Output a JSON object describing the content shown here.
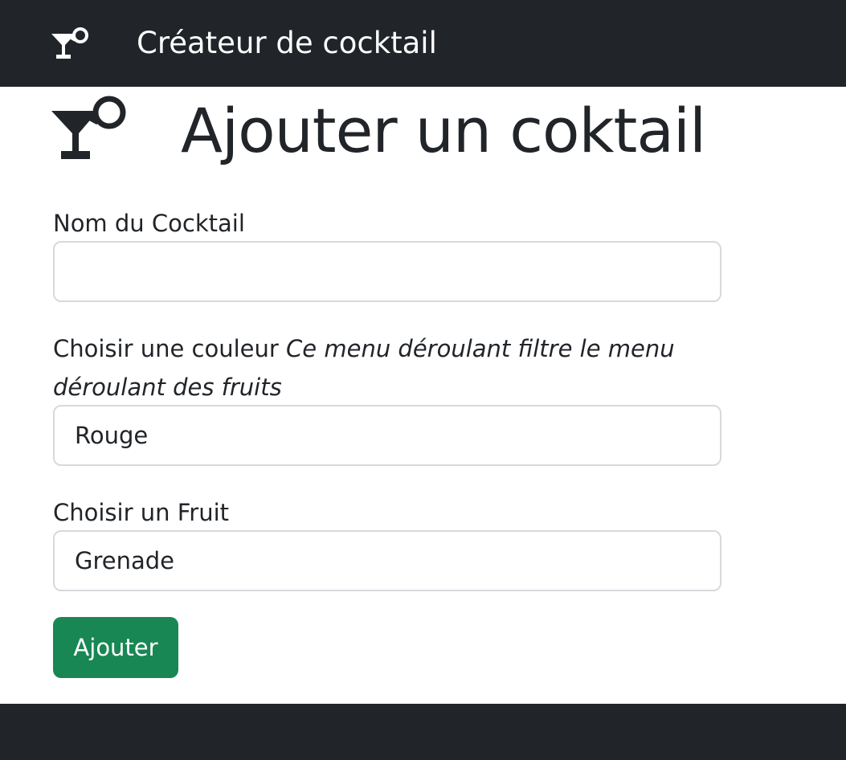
{
  "navbar": {
    "icon": "cocktail-icon",
    "title": "Créateur de cocktail"
  },
  "page": {
    "icon": "cocktail-icon",
    "title": "Ajouter un coktail"
  },
  "form": {
    "name_label": "Nom du Cocktail",
    "name_value": "",
    "color_label": "Choisir une couleur",
    "color_hint_line1": "Ce menu déroulant filtre le menu",
    "color_hint_line2": "déroulant des fruits",
    "color_value": "Rouge",
    "fruit_label": "Choisir un Fruit",
    "fruit_value": "Grenade",
    "submit_label": "Ajouter"
  },
  "colors": {
    "navbar": "#212529",
    "submit": "#198754",
    "border": "#d7d9dd"
  }
}
